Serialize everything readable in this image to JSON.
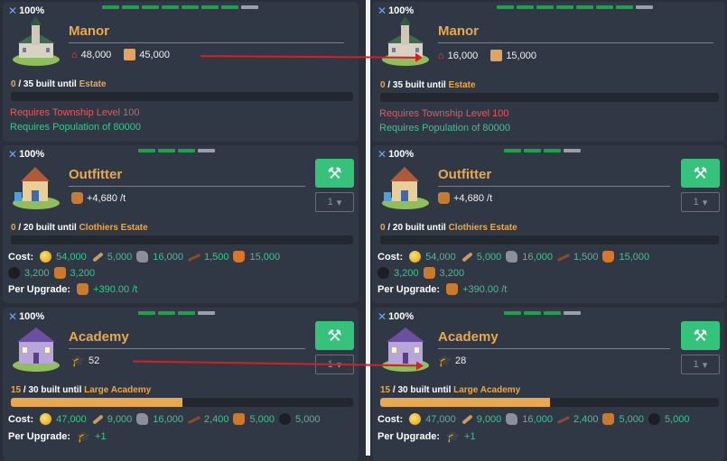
{
  "left": {
    "manor": {
      "pct": "100%",
      "name": "Manor",
      "stat1": "48,000",
      "stat2": "45,000",
      "built_count": "0",
      "built_total": " / 35 built until ",
      "built_target": "Estate",
      "progress": 0,
      "req1": "Requires Township Level 100",
      "req2": "Requires Population of 80000",
      "levels_filled": 7,
      "levels_total": 8
    },
    "outfitter": {
      "pct": "100%",
      "name": "Outfitter",
      "stat1": "+4,680 /t",
      "built_count": "0",
      "built_total": " / 20 built until ",
      "built_target": "Clothiers Estate",
      "progress": 0,
      "qty": "1",
      "cost_label": "Cost:",
      "costs": [
        "54,000",
        "5,000",
        "16,000",
        "1,500",
        "15,000",
        "3,200",
        "3,200"
      ],
      "upgrade_label": "Per Upgrade:",
      "upgrade": "+390.00 /t",
      "levels_filled": 3,
      "levels_total": 4
    },
    "academy": {
      "pct": "100%",
      "name": "Academy",
      "stat1": "52",
      "built_count": "15",
      "built_total": " / 30 built until ",
      "built_target": "Large Academy",
      "progress": 0.5,
      "qty": "1",
      "cost_label": "Cost:",
      "costs": [
        "47,000",
        "9,000",
        "16,000",
        "2,400",
        "5,000",
        "5,000"
      ],
      "upgrade_label": "Per Upgrade:",
      "upgrade": "+1",
      "levels_filled": 3,
      "levels_total": 4
    }
  },
  "right": {
    "manor": {
      "pct": "100%",
      "name": "Manor",
      "stat1": "16,000",
      "stat2": "15,000",
      "built_count": "0",
      "built_total": " / 35 built until ",
      "built_target": "Estate",
      "progress": 0,
      "req1": "Requires Township Level 100",
      "req2": "Requires Population of 80000",
      "levels_filled": 7,
      "levels_total": 8
    },
    "outfitter": {
      "pct": "100%",
      "name": "Outfitter",
      "stat1": "+4,680 /t",
      "built_count": "0",
      "built_total": " / 20 built until ",
      "built_target": "Clothiers Estate",
      "progress": 0,
      "qty": "1",
      "cost_label": "Cost:",
      "costs": [
        "54,000",
        "5,000",
        "16,000",
        "1,500",
        "15,000",
        "3,200",
        "3,200"
      ],
      "upgrade_label": "Per Upgrade:",
      "upgrade": "+390.00 /t",
      "levels_filled": 3,
      "levels_total": 4
    },
    "academy": {
      "pct": "100%",
      "name": "Academy",
      "stat1": "28",
      "built_count": "15",
      "built_total": " / 30 built until ",
      "built_target": "Large Academy",
      "progress": 0.5,
      "qty": "1",
      "cost_label": "Cost:",
      "costs": [
        "47,000",
        "9,000",
        "16,000",
        "2,400",
        "5,000",
        "5,000"
      ],
      "upgrade_label": "Per Upgrade:",
      "upgrade": "+1",
      "levels_filled": 3,
      "levels_total": 4
    }
  },
  "colors": {
    "accent": "#e8a84e",
    "green": "#3cc48a",
    "button": "#35c37c",
    "warning": "#e05a5a",
    "arrow": "#d42020"
  }
}
